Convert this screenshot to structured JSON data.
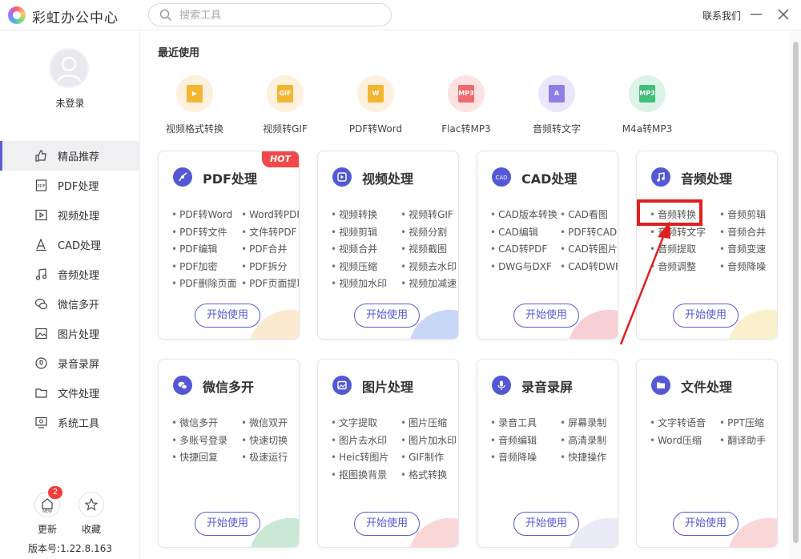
{
  "app": {
    "title": "彩虹办公中心",
    "contact": "联系我们"
  },
  "search": {
    "placeholder": "搜索工具"
  },
  "user": {
    "login_status": "未登录"
  },
  "sidebar": {
    "items": [
      {
        "label": "精品推荐",
        "icon": "thumbs-up-icon",
        "active": true
      },
      {
        "label": "PDF处理",
        "icon": "pdf-icon"
      },
      {
        "label": "视频处理",
        "icon": "video-icon"
      },
      {
        "label": "CAD处理",
        "icon": "cad-icon"
      },
      {
        "label": "音频处理",
        "icon": "music-icon"
      },
      {
        "label": "微信多开",
        "icon": "wechat-icon"
      },
      {
        "label": "图片处理",
        "icon": "image-icon"
      },
      {
        "label": "录音录屏",
        "icon": "record-icon"
      },
      {
        "label": "文件处理",
        "icon": "folder-icon"
      },
      {
        "label": "系统工具",
        "icon": "monitor-icon"
      }
    ],
    "update_label": "更新",
    "update_badge": "2",
    "favorite_label": "收藏",
    "version": "版本号:1.22.8.163"
  },
  "main": {
    "recent_title": "最近使用",
    "recent": [
      {
        "label": "视频格式转换",
        "file_text": "▶",
        "file_color": "#f3b632",
        "bg": "#fdf1dd"
      },
      {
        "label": "视频转GIF",
        "file_text": "GIF",
        "file_color": "#f3b632",
        "bg": "#fdf1dd"
      },
      {
        "label": "PDF转Word",
        "file_text": "W",
        "file_color": "#f3b632",
        "bg": "#fdf1dd"
      },
      {
        "label": "Flac转MP3",
        "file_text": "MP3",
        "file_color": "#ee6b6b",
        "bg": "#fde2e2"
      },
      {
        "label": "音频转文字",
        "file_text": "A",
        "file_color": "#8f7de8",
        "bg": "#ebe6fb"
      },
      {
        "label": "M4a转MP3",
        "file_text": "MP3",
        "file_color": "#3fbf7a",
        "bg": "#dcf4e7"
      }
    ],
    "start_label": "开始使用",
    "hot_label": "HOT",
    "cards": [
      {
        "title": "PDF处理",
        "icon": "pdf-icon",
        "items": [
          "PDF转Word",
          "Word转PDF",
          "PDF转文件",
          "文件转PDF",
          "PDF编辑",
          "PDF合并",
          "PDF加密",
          "PDF拆分",
          "PDF删除页面",
          "PDF页面提取"
        ]
      },
      {
        "title": "视频处理",
        "icon": "video-icon",
        "items": [
          "视频转换",
          "视频转GIF",
          "视频剪辑",
          "视频分割",
          "视频合并",
          "视频截图",
          "视频压缩",
          "视频去水印",
          "视频加水印",
          "视频加减速"
        ]
      },
      {
        "title": "CAD处理",
        "icon": "cad-icon",
        "items": [
          "CAD版本转换",
          "CAD看图",
          "CAD编辑",
          "PDF转CAD",
          "CAD转PDF",
          "CAD转图片",
          "DWG与DXF",
          "CAD转DWF"
        ]
      },
      {
        "title": "音频处理",
        "icon": "music-icon",
        "items": [
          "音频转换",
          "音频剪辑",
          "音频转文字",
          "音频合并",
          "音频提取",
          "音频变速",
          "音频调整",
          "音频降噪"
        ]
      },
      {
        "title": "微信多开",
        "icon": "wechat-icon",
        "items": [
          "微信多开",
          "微信双开",
          "多账号登录",
          "快速切换",
          "快捷回复",
          "极速运行"
        ]
      },
      {
        "title": "图片处理",
        "icon": "image-icon",
        "items": [
          "文字提取",
          "图片压缩",
          "图片去水印",
          "图片加水印",
          "Heic转图片",
          "GIF制作",
          "抠图换背景",
          "格式转换"
        ]
      },
      {
        "title": "录音录屏",
        "icon": "mic-icon",
        "items": [
          "录音工具",
          "屏幕录制",
          "音频编辑",
          "高清录制",
          "音频降噪",
          "快捷操作"
        ]
      },
      {
        "title": "文件处理",
        "icon": "folder-icon",
        "items": [
          "文字转语音",
          "PPT压缩",
          "Word压缩",
          "翻译助手"
        ]
      }
    ]
  },
  "colors": {
    "accent": "#5558d6",
    "hot": "#f2484a",
    "highlight": "#e21f1f"
  }
}
